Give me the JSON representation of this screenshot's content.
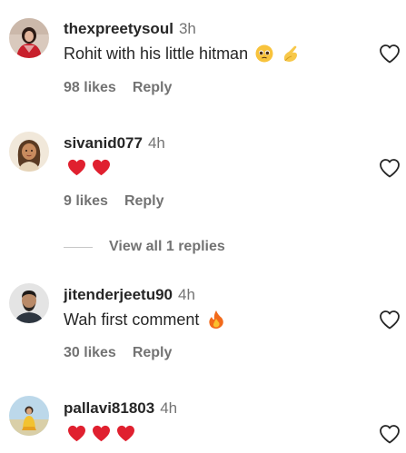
{
  "comments": [
    {
      "username": "thexpreetysoul",
      "time": "3h",
      "text": "Rohit with his little hitman",
      "emojis": [
        "pleading-face-emoji",
        "clapping-hand-emoji"
      ],
      "likes": "98 likes",
      "reply_label": "Reply"
    },
    {
      "username": "sivanid077",
      "time": "4h",
      "text": "",
      "emojis": [
        "red-heart-emoji",
        "red-heart-emoji"
      ],
      "likes": "9 likes",
      "reply_label": "Reply"
    },
    {
      "username": "jitenderjeetu90",
      "time": "4h",
      "text": "Wah first comment",
      "emojis": [
        "fire-emoji"
      ],
      "likes": "30 likes",
      "reply_label": "Reply"
    },
    {
      "username": "pallavi81803",
      "time": "4h",
      "text": "",
      "emojis": [
        "red-heart-emoji",
        "red-heart-emoji",
        "red-heart-emoji"
      ],
      "likes": "",
      "reply_label": ""
    }
  ],
  "view_replies_label": "View all 1 replies",
  "colors": {
    "text": "#262626",
    "muted": "#737373",
    "heart": "#e0202f"
  }
}
